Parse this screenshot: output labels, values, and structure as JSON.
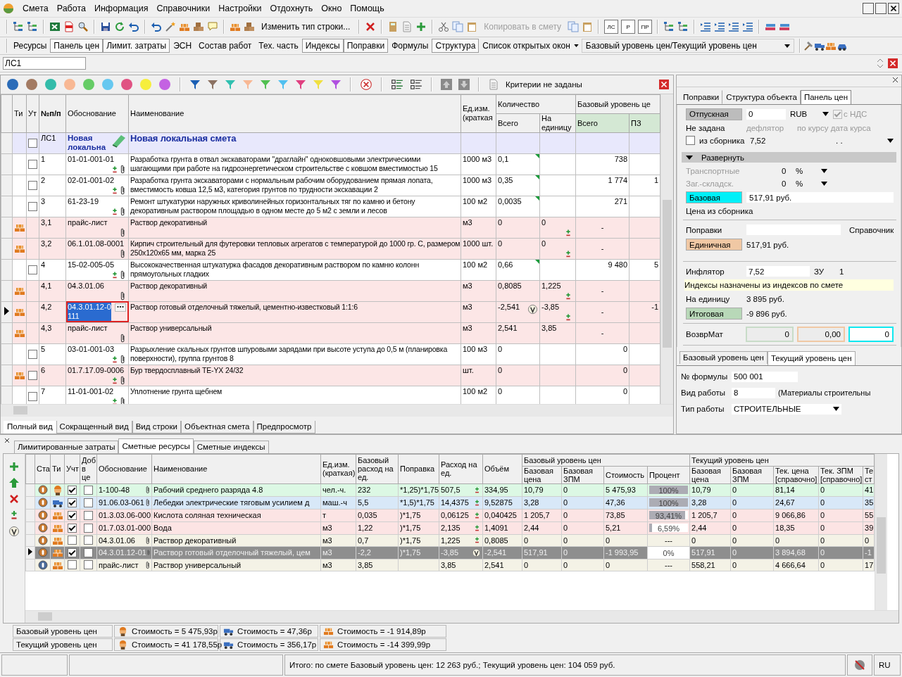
{
  "menu": [
    "Смета",
    "Работа",
    "Информация",
    "Справочники",
    "Настройки",
    "Отдохнуть",
    "Окно",
    "Помощь"
  ],
  "toolbar": {
    "change_type_button": "Изменить тип строки...",
    "copy_button": {
      "label": "Копировать в смету",
      "disabled": true
    },
    "doc_buttons": [
      "ЛС",
      "Р",
      "ПР"
    ]
  },
  "panels_bar": {
    "buttons": [
      {
        "label": "Ресурсы",
        "pressed": false
      },
      {
        "label": "Панель цен",
        "pressed": true
      },
      {
        "label": "Лимит. затраты",
        "pressed": true
      },
      {
        "label": "ЭСН",
        "pressed": false
      },
      {
        "label": "Состав работ",
        "pressed": false
      },
      {
        "label": "Тех. часть",
        "pressed": false
      },
      {
        "label": "Индексы",
        "pressed": true
      },
      {
        "label": "Поправки",
        "pressed": true
      },
      {
        "label": "Формулы",
        "pressed": false
      },
      {
        "label": "Структура",
        "pressed": true
      }
    ],
    "windows_menu": "Список открытых окон",
    "level_combo": "Базовый уровень цен/Текущий уровень цен"
  },
  "address": {
    "value": "ЛС1"
  },
  "filter_bar": {
    "color_marks": [
      {
        "color": "#2b6cb8"
      },
      {
        "color": "#a37a62"
      },
      {
        "color": "#33bcaa"
      },
      {
        "color": "#f8b894"
      },
      {
        "color": "#66cc66"
      },
      {
        "color": "#66c8f0"
      },
      {
        "color": "#e05282"
      },
      {
        "color": "#f6ee3c"
      },
      {
        "color": "#c462e2"
      }
    ],
    "color_filters": [
      {
        "color": "#1a5fb4"
      },
      {
        "color": "#8c7262"
      },
      {
        "color": "#30c0b0"
      },
      {
        "color": "#f8b894"
      },
      {
        "color": "#50c050"
      },
      {
        "color": "#50c0f0"
      },
      {
        "color": "#e04080"
      },
      {
        "color": "#f0e040"
      },
      {
        "color": "#b050e0"
      }
    ],
    "criteria": "Критерии не заданы"
  },
  "estimate_table": {
    "headers": {
      "type": "Ти",
      "count": "Ут",
      "num": "№п/п",
      "basis": "Обоснование",
      "name": "Наименование",
      "unit": "Ед.изм. (краткая",
      "qty": "Количество",
      "qty_total": "Всего",
      "qty_unit": "На единицу",
      "base": "Базовый уровень це",
      "base_total": "Всего",
      "base_pz": "ПЗ"
    },
    "rows": [
      {
        "kind": "section",
        "selected": false,
        "checked": false,
        "num": "ЛС1",
        "basis": "Новая локальна",
        "name": "Новая локальная смета"
      },
      {
        "kind": "work",
        "selected": false,
        "checked": false,
        "num": "1",
        "basis": "01-01-001-01",
        "code_adjust": true,
        "clip": true,
        "name": "Разработка грунта в отвал экскаваторами \"драглайн\" одноковшовыми электрическими шагающими при работе на гидроэнергетическом строительстве с ковшом вместимостью 15",
        "unit": "1000 м3",
        "total": "0,1",
        "qty_flag": true,
        "unit_adjust": false,
        "warning": false,
        "base_total": "738"
      },
      {
        "kind": "work",
        "selected": false,
        "checked": false,
        "num": "2",
        "basis": "02-01-001-02",
        "code_adjust": true,
        "clip": true,
        "name": "Разработка грунта экскаваторами с нормальным рабочим оборудованием прямая лопата, вместимость ковша 12,5 м3, категория грунтов по трудности экскавации 2",
        "unit": "1000 м3",
        "total": "0,35",
        "qty_flag": true,
        "unit_adjust": false,
        "warning": false,
        "base_total": "1 774",
        "base_pz": "1"
      },
      {
        "kind": "work",
        "selected": false,
        "checked": false,
        "num": "3",
        "basis": "61-23-19",
        "code_adjust": true,
        "clip": true,
        "name": "Ремонт штукатурки наружных криволинейных горизонтальных тяг по камню и бетону декоративным раствором площадью в одном месте до 5 м2 с земли и лесов",
        "unit": "100 м2",
        "total": "0,0035",
        "qty_flag": true,
        "unit_adjust": false,
        "warning": false,
        "base_total": "271"
      },
      {
        "kind": "material",
        "selected": false,
        "num": "3,1",
        "basis": "прайс-лист",
        "code_adjust": false,
        "clip": true,
        "name": "Раствор декоративный",
        "unit": "м3",
        "total": "0",
        "qty_flag": false,
        "warning": false,
        "per_unit": "0",
        "unit_adjust": true,
        "base_total": "-"
      },
      {
        "kind": "material",
        "selected": false,
        "num": "3,2",
        "basis": "06.1.01.08-0001",
        "code_adjust": false,
        "clip": true,
        "name": "Кирпич строительный для футеровки тепловых агрегатов с температурой до 1000 гр. С, размером 250х120х65 мм, марка 25",
        "unit": "1000 шт.",
        "total": "0",
        "qty_flag": false,
        "warning": false,
        "per_unit": "0",
        "unit_adjust": true,
        "base_total": "-"
      },
      {
        "kind": "work",
        "selected": false,
        "checked": false,
        "num": "4",
        "basis": "15-02-005-05",
        "code_adjust": true,
        "clip": true,
        "name": "Высококачественная штукатурка фасадов декоративным раствором по камню колонн прямоугольных гладких",
        "unit": "100 м2",
        "total": "0,66",
        "qty_flag": true,
        "unit_adjust": false,
        "warning": false,
        "base_total": "9 480",
        "base_pz": "5"
      },
      {
        "kind": "material",
        "selected": false,
        "num": "4,1",
        "basis": "04.3.01.06",
        "code_adjust": false,
        "clip": true,
        "name": "Раствор декоративный",
        "unit": "м3",
        "total": "0,8085",
        "qty_flag": false,
        "warning": false,
        "per_unit": "1,225",
        "unit_adjust": true,
        "base_total": "-"
      },
      {
        "kind": "material",
        "selected": true,
        "num": "4,2",
        "basis": "04.3.01.12-0111",
        "code_adjust": false,
        "clip": false,
        "name": "Раствор готовый отделочный тяжелый, цементно-известковый 1:1:6",
        "unit": "м3",
        "total": "-2,541",
        "qty_flag": false,
        "warning": true,
        "per_unit": "-3,85",
        "unit_adjust": true,
        "base_total": "-",
        "base_pz": "-1"
      },
      {
        "kind": "material",
        "selected": false,
        "num": "4,3",
        "basis": "прайс-лист",
        "code_adjust": false,
        "clip": true,
        "name": "Раствор универсальный",
        "unit": "м3",
        "total": "2,541",
        "qty_flag": false,
        "warning": false,
        "per_unit": "3,85",
        "unit_adjust": false,
        "base_total": "-"
      },
      {
        "kind": "work",
        "selected": false,
        "checked": false,
        "num": "5",
        "basis": "03-01-001-03",
        "code_adjust": true,
        "clip": true,
        "name": "Разрыхление скальных грунтов шпуровыми зарядами при высоте уступа до 0,5 м (планировка поверхности), группа грунтов 8",
        "unit": "100 м3",
        "total": "0",
        "qty_flag": false,
        "unit_adjust": false,
        "warning": false,
        "base_total": "0"
      },
      {
        "kind": "material",
        "selected": false,
        "checked": false,
        "num": "6",
        "basis": "01.7.17.09-0006",
        "code_adjust": true,
        "clip": true,
        "name": "Бур твердосплавный ТЕ-YX 24/32",
        "unit": "шт.",
        "total": "0",
        "qty_flag": false,
        "unit_adjust": false,
        "warning": false,
        "base_total": "0"
      },
      {
        "kind": "work",
        "selected": false,
        "checked": false,
        "num": "7",
        "basis": "11-01-001-02",
        "code_adjust": true,
        "clip": true,
        "name": "Уплотнение грунта щебнем",
        "unit": "100 м2",
        "total": "0",
        "qty_flag": false,
        "unit_adjust": false,
        "warning": false,
        "base_total": "0"
      }
    ]
  },
  "view_tabs": [
    {
      "label": "Полный вид",
      "selected": true
    },
    {
      "label": "Сокращенный вид",
      "selected": false
    },
    {
      "label": "Вид строки",
      "selected": false
    },
    {
      "label": "Объектная смета",
      "selected": false
    },
    {
      "label": "Предпросмотр",
      "selected": false
    }
  ],
  "price_panel": {
    "tabs": [
      {
        "label": "Поправки",
        "selected": false
      },
      {
        "label": "Структура объекта",
        "selected": false
      },
      {
        "label": "Панель цен",
        "selected": true
      }
    ],
    "release_button": "Отпускная",
    "release_value": "0",
    "currency": "RUB",
    "vat": {
      "label": "с НДС",
      "checked": true,
      "disabled": true
    },
    "not_set": "Не задана",
    "deflator_label": "дефлятор",
    "rate_label": "по курсу дата курса",
    "from_collection": {
      "label": "из сборника",
      "checked": false
    },
    "collection_value": "7,52",
    "rate_date": ". .",
    "expand_label": "Развернуть",
    "charges": [
      {
        "label": "Транспортные",
        "value": "0",
        "unit": "%",
        "disabled": true
      },
      {
        "label": "Заг.-складск.",
        "value": "0",
        "unit": "%",
        "disabled": true
      }
    ],
    "base_button": "Базовая",
    "base_value": "517,91 руб.",
    "collection_price": "Цена из сборника",
    "adjustments_label": "Поправки",
    "reference": "Справочник",
    "unit_button": "Единичная",
    "unit_value": "517,91 руб.",
    "inflator_label": "Инфлятор",
    "inflator_value": "7,52",
    "zu_label": "ЗУ",
    "zu_value": "1",
    "note": "Индексы назначены из индексов по смете",
    "per_unit_label": "На единицу",
    "per_unit_value": "3 895 руб.",
    "total_button": "Итоговая",
    "total_value": "-9 896 руб.",
    "return_label": "ВозврМат",
    "return_values": [
      "0",
      "0,00",
      "0"
    ],
    "level_tabs": [
      {
        "label": "Базовый уровень цен",
        "selected": false
      },
      {
        "label": "Текущий уровень цен",
        "selected": true
      }
    ],
    "formula_label": "№ формулы",
    "formula_value": "500 001",
    "work_kind_label": "Вид работы",
    "work_kind_value": "8",
    "work_kind_name": "(Материалы строительны",
    "work_type_label": "Тип работы",
    "work_type_value": "СТРОИТЕЛЬНЫЕ"
  },
  "resources": {
    "tabs": [
      {
        "label": "Лимитированные затраты",
        "selected": false
      },
      {
        "label": "Сметные ресурсы",
        "selected": true
      },
      {
        "label": "Сметные индексы",
        "selected": false
      }
    ],
    "headers": {
      "status": "Ста",
      "type": "Ти",
      "counted": "Учт",
      "added": "Доб в це",
      "basis": "Обоснование",
      "name": "Наименование",
      "unit": "Ед.изм. (краткая)",
      "base_rate": "Базовый расход на ед.",
      "adjust": "Поправка",
      "rate": "Расход на ед.",
      "volume": "Объём",
      "base_group": "Базовый уровень цен",
      "base_price": "Базовая цена",
      "base_zpm": "Базовая ЗПМ",
      "cost": "Стоимость",
      "percent": "Процент",
      "cur_group": "Текущий уровень цен",
      "cur_price": "Базовая цена",
      "cur_zpm": "Базовая ЗПМ",
      "ref_price": "Тек. цена [справочно]",
      "ref_zpm": "Тек. ЗПМ [справочно]",
      "cur_cost": "Те ст"
    },
    "rows": [
      {
        "price_list": false,
        "kind": "labor",
        "counted": true,
        "added": false,
        "selected": false,
        "basis": "1-100-48",
        "name": "Рабочий среднего разряда 4.8",
        "unit": "чел.-ч.",
        "base_rate": "232",
        "adjust": "*1,25)*1,75",
        "rate": "507,5",
        "rate_adjust": true,
        "rate_warning": false,
        "volume": "334,95",
        "base_price": "10,79",
        "base_zpm": "0",
        "cost": "5 475,93",
        "percent": "100%",
        "level": 1,
        "cur_price": "10,79",
        "cur_zpm": "0",
        "ref_price": "81,14",
        "ref_zpm": "0",
        "cur_cost": "41"
      },
      {
        "price_list": false,
        "kind": "machine",
        "counted": true,
        "added": false,
        "selected": false,
        "basis": "91.06.03-061",
        "name": "Лебедки электрические тяговым усилием д",
        "unit": "маш.-ч",
        "base_rate": "5,5",
        "adjust": "*1,5)*1,75",
        "rate": "14,4375",
        "rate_adjust": true,
        "rate_warning": false,
        "volume": "9,52875",
        "base_price": "3,28",
        "base_zpm": "0",
        "cost": "47,36",
        "percent": "100%",
        "level": 1,
        "cur_price": "3,28",
        "cur_zpm": "0",
        "ref_price": "24,67",
        "ref_zpm": "0",
        "cur_cost": "35"
      },
      {
        "price_list": false,
        "kind": "material",
        "counted": true,
        "added": false,
        "selected": false,
        "basis": "01.3.03.06-000",
        "name": "Кислота соляная техническая",
        "unit": "т",
        "base_rate": "0,035",
        "adjust": ")*1,75",
        "rate": "0,06125",
        "rate_adjust": true,
        "rate_warning": false,
        "volume": "0,040425",
        "base_price": "1 205,7",
        "base_zpm": "0",
        "cost": "73,85",
        "percent": "93,41%",
        "level": 0.9341,
        "cur_price": "1 205,7",
        "cur_zpm": "0",
        "ref_price": "9 066,86",
        "ref_zpm": "0",
        "cur_cost": "55"
      },
      {
        "price_list": false,
        "kind": "material",
        "counted": true,
        "added": false,
        "selected": false,
        "basis": "01.7.03.01-000",
        "name": "Вода",
        "unit": "м3",
        "base_rate": "1,22",
        "adjust": ")*1,75",
        "rate": "2,135",
        "rate_adjust": true,
        "rate_warning": false,
        "volume": "1,4091",
        "base_price": "2,44",
        "base_zpm": "0",
        "cost": "5,21",
        "percent": "6,59%",
        "level": 0.0659,
        "cur_price": "2,44",
        "cur_zpm": "0",
        "ref_price": "18,35",
        "ref_zpm": "0",
        "cur_cost": "39"
      },
      {
        "price_list": false,
        "kind": "material",
        "counted": false,
        "added": false,
        "selected": false,
        "basis": "04.3.01.06",
        "name": "Раствор декоративный",
        "unit": "м3",
        "base_rate": "0,7",
        "adjust": ")*1,75",
        "rate": "1,225",
        "rate_adjust": true,
        "rate_warning": false,
        "volume": "0,8085",
        "base_price": "0",
        "base_zpm": "0",
        "cost": "0",
        "percent": "---",
        "cur_price": "0",
        "cur_zpm": "0",
        "ref_price": "0",
        "ref_zpm": "0",
        "cur_cost": "0"
      },
      {
        "price_list": false,
        "kind": "material",
        "counted": true,
        "added": false,
        "selected": true,
        "basis": "04.3.01.12-01",
        "name": "Раствор готовый отделочный тяжелый, цем",
        "unit": "м3",
        "base_rate": "-2,2",
        "adjust": ")*1,75",
        "rate": "-3,85",
        "rate_adjust": false,
        "rate_warning": true,
        "volume": "-2,541",
        "base_price": "517,91",
        "base_zpm": "0",
        "cost": "-1 993,95",
        "percent": "0%",
        "level": 0,
        "cur_price": "517,91",
        "cur_zpm": "0",
        "ref_price": "3 894,68",
        "ref_zpm": "0",
        "cur_cost": "-1"
      },
      {
        "price_list": true,
        "kind": "material",
        "counted": false,
        "added": false,
        "selected": false,
        "basis": "прайс-лист",
        "name": "Раствор универсальный",
        "unit": "м3",
        "base_rate": "3,85",
        "rate": "3,85",
        "rate_adjust": false,
        "rate_warning": false,
        "volume": "2,541",
        "base_price": "0",
        "base_zpm": "0",
        "cost": "0",
        "percent": "---",
        "cur_price": "558,21",
        "cur_zpm": "0",
        "ref_price": "4 666,64",
        "ref_zpm": "0",
        "cur_cost": "17"
      }
    ],
    "totals": [
      {
        "label": "Базовый уровень цен",
        "labor": "Стоимость = 5 475,93р",
        "machines": "Стоимость = 47,36р",
        "materials": "Стоимость = -1 914,89р"
      },
      {
        "label": "Текущий уровень цен",
        "labor": "Стоимость = 41 178,55р",
        "machines": "Стоимость = 356,17р",
        "materials": "Стоимость = -14 399,99р"
      }
    ]
  },
  "status_bar": {
    "total": "Итого: по смете Базовый уровень цен: 12 263 руб.;  Текущий уровень цен: 104 059 руб.",
    "language": "RU"
  }
}
